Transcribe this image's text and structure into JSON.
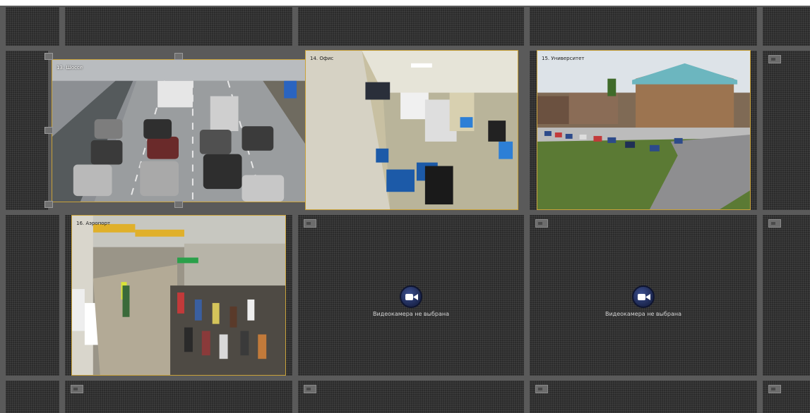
{
  "cameras": [
    {
      "label": "13. Шоссе",
      "kind": "highway"
    },
    {
      "label": "14. Офис",
      "kind": "office"
    },
    {
      "label": "15. Университет",
      "kind": "university"
    },
    {
      "label": "16. Аэропорт",
      "kind": "airport"
    }
  ],
  "empty_slot": {
    "message": "Видеокамера не выбрана",
    "icon": "video-camera-icon"
  },
  "colors": {
    "selection_border": "#c9a23a",
    "grid_gap": "#5a5a5a",
    "cell_bg": "#2b2b2b"
  }
}
